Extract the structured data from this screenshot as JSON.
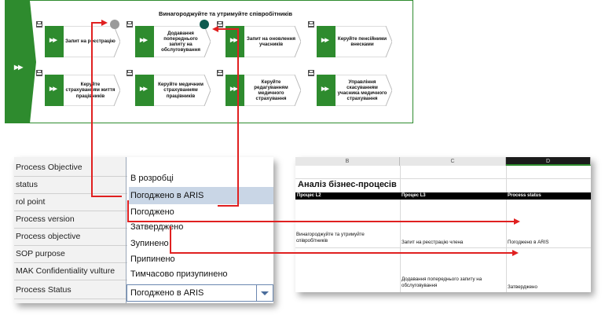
{
  "diagram": {
    "title": "Винагороджуйте та утримуйте співробітників",
    "marker": "▶▶",
    "steps_row1": [
      "Запит на реєстрацію",
      "Додавання попереднього запиту на обслуговування",
      "Запит на оновлення учасників",
      "Керуйте пенсійними внесками"
    ],
    "steps_row2": [
      "Керуйте страхуванням життя працівників",
      "Керуйте медичним страхуванням працівників",
      "Керуйте редагуванням медичного страхування",
      "Управління скасуванням учасника медичного страхування"
    ],
    "dot_colors": {
      "grey": "#9a9a9a",
      "teal": "#0d5a4f"
    }
  },
  "properties": {
    "labels": [
      "Process Objective",
      "status",
      "rol point",
      "Process version",
      "Process objective",
      "SOP purpose",
      "MAK Confidentiality vulture",
      "Process Status"
    ],
    "options": [
      "В розробці",
      "Погоджено в ARIS",
      "Погоджено",
      "Затверджено",
      "Зупинено",
      "Припинено",
      "Тимчасово призупинено"
    ],
    "selected_value": "Погоджено в ARIS"
  },
  "sheet": {
    "col_headers": [
      "B",
      "C",
      "D"
    ],
    "title": "Аналіз бізнес-процесів",
    "columns": [
      "Процес L2",
      "Процес L3",
      "Process status"
    ],
    "rows": [
      [
        "Винагороджуйте та утримуйте співробітників",
        "Запит на реєстрацію члена",
        "Погоджено в ARIS"
      ],
      [
        "",
        "Додавання попереднього запиту на обслуговування",
        "Затверджено"
      ]
    ]
  },
  "colors": {
    "green": "#2e8b2e",
    "arrow": "#e02020",
    "selection": "#c9d6e6"
  }
}
